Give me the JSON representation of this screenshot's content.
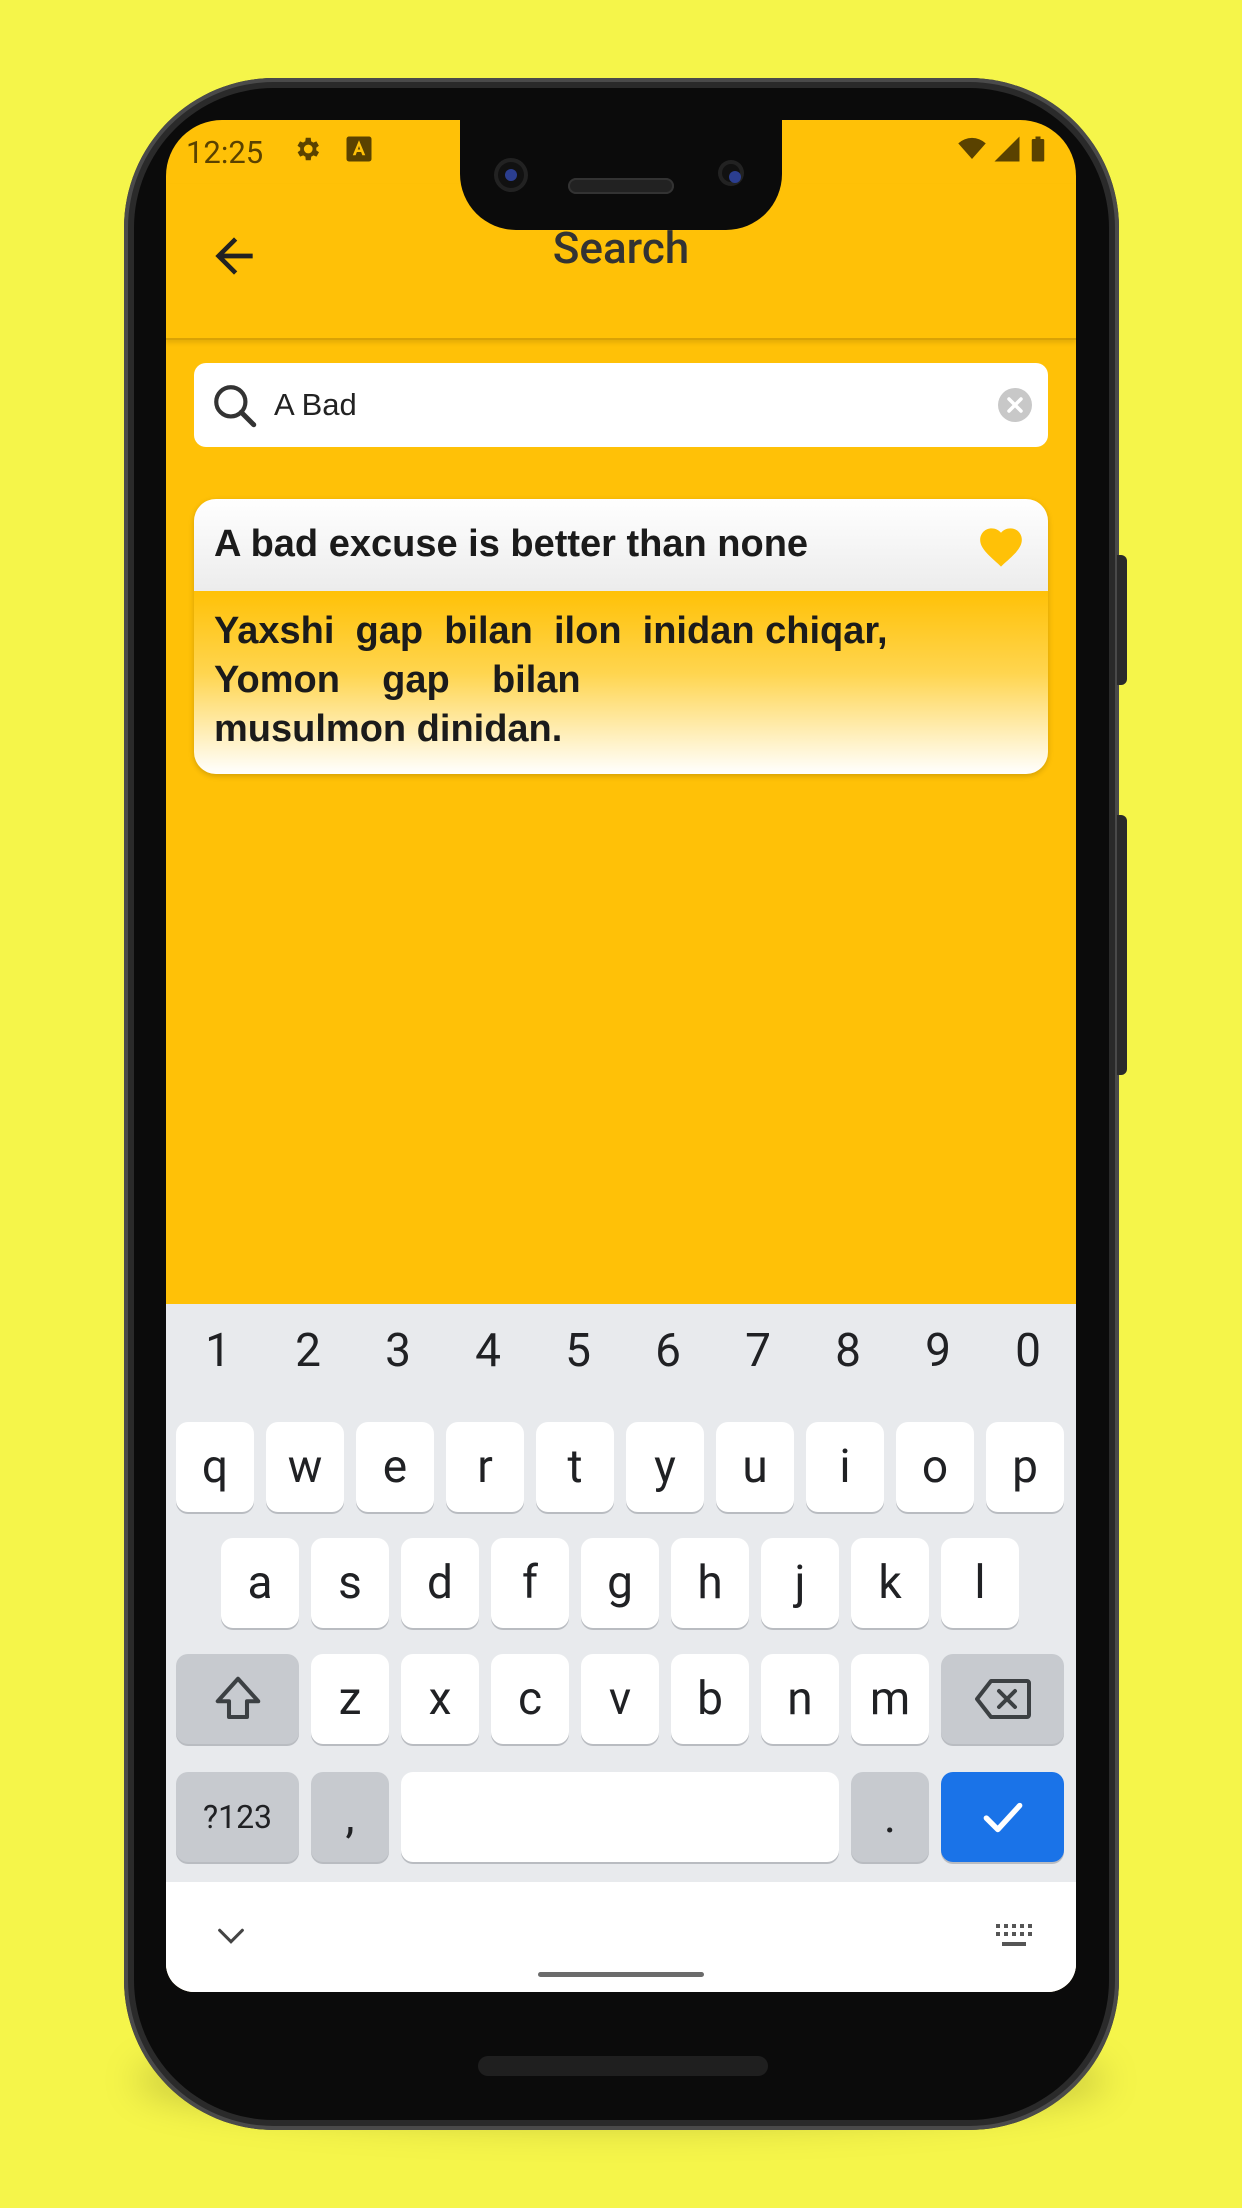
{
  "status_bar": {
    "time": "12:25"
  },
  "app_bar": {
    "title": "Search"
  },
  "search": {
    "value": "A Bad",
    "placeholder": ""
  },
  "results": [
    {
      "title": "A bad excuse is better than none",
      "translation": "Yaxshi  gap  bilan  ilon  inidan chiqar,\nYomon    gap    bilan\nmusulmon dinidan."
    }
  ],
  "keyboard": {
    "numbers": [
      "1",
      "2",
      "3",
      "4",
      "5",
      "6",
      "7",
      "8",
      "9",
      "0"
    ],
    "row1": [
      "q",
      "w",
      "e",
      "r",
      "t",
      "y",
      "u",
      "i",
      "o",
      "p"
    ],
    "row2": [
      "a",
      "s",
      "d",
      "f",
      "g",
      "h",
      "j",
      "k",
      "l"
    ],
    "row3": [
      "z",
      "x",
      "c",
      "v",
      "b",
      "n",
      "m"
    ],
    "symbols_label": "?123",
    "comma": ",",
    "period": "."
  },
  "colors": {
    "accent": "#ffc107",
    "background": "#f5f54a",
    "enter_key": "#1a73e8"
  }
}
